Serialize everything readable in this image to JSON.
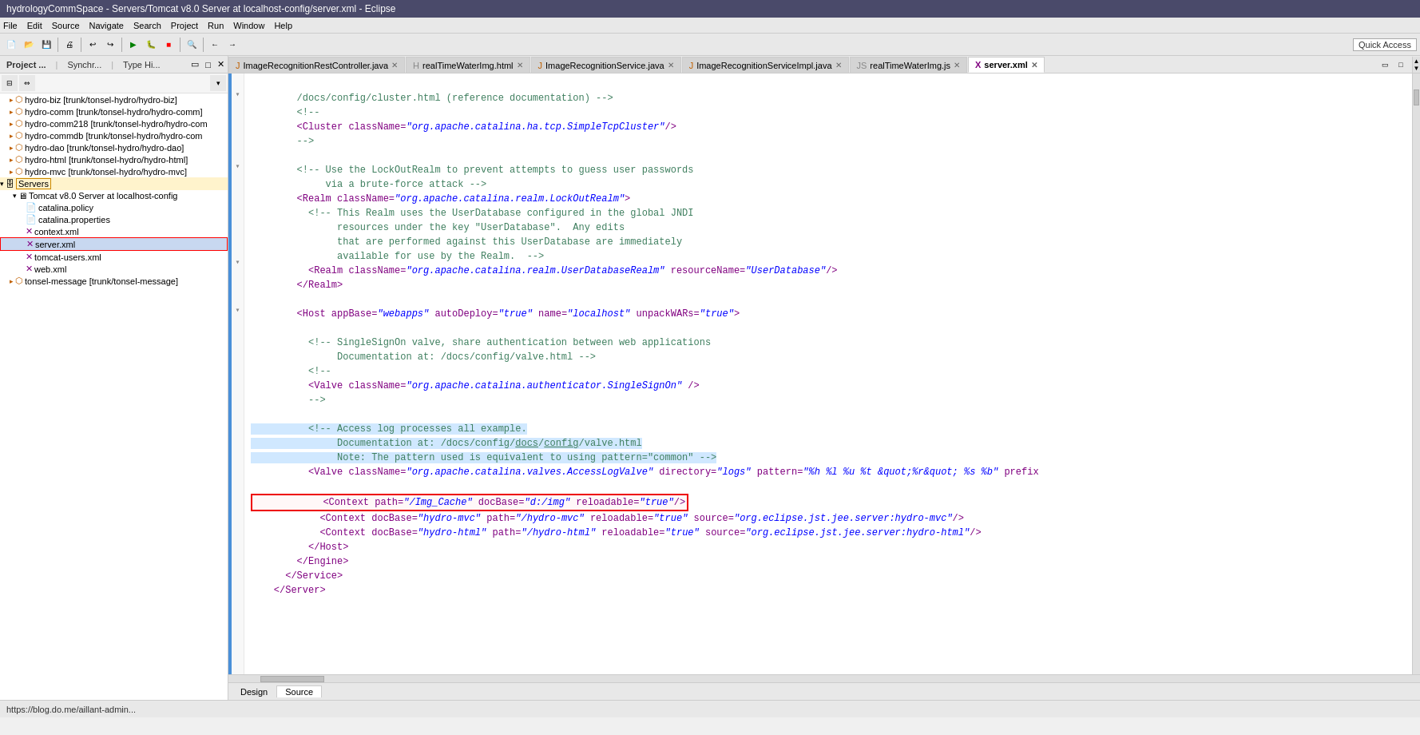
{
  "titlebar": {
    "text": "hydrologyCommSpace - Servers/Tomcat v8.0 Server at localhost-config/server.xml - Eclipse"
  },
  "menubar": {
    "items": [
      "File",
      "Edit",
      "Source",
      "Navigate",
      "Search",
      "Project",
      "Run",
      "Window",
      "Help"
    ]
  },
  "quick_access": "Quick Access",
  "tabs": [
    {
      "label": "ImageRecognitionRestController.java",
      "active": false
    },
    {
      "label": "realTimeWaterImg.html",
      "active": false
    },
    {
      "label": "ImageRecognitionService.java",
      "active": false
    },
    {
      "label": "ImageRecognitionServiceImpl.java",
      "active": false
    },
    {
      "label": "realTimeWaterImg.js",
      "active": false
    },
    {
      "label": "server.xml",
      "active": true
    }
  ],
  "left_panel": {
    "tabs": [
      "Project ...",
      "Synchr...",
      "Type Hi..."
    ]
  },
  "tree": [
    {
      "id": "hydro-biz",
      "label": "hydro-biz [trunk/tonsel-hydro/hydro-biz]",
      "indent": 12,
      "icon": "▸",
      "level": 0
    },
    {
      "id": "hydro-comm",
      "label": "hydro-comm [trunk/tonsel-hydro/hydro-comm]",
      "indent": 12,
      "icon": "▸",
      "level": 0
    },
    {
      "id": "hydro-comm218",
      "label": "hydro-comm218 [trunk/tonsel-hydro/hydro-com",
      "indent": 12,
      "icon": "▸",
      "level": 0
    },
    {
      "id": "hydro-commdb",
      "label": "hydro-commdb [trunk/tonsel-hydro/hydro-com",
      "indent": 12,
      "icon": "▸",
      "level": 0
    },
    {
      "id": "hydro-dao",
      "label": "hydro-dao [trunk/tonsel-hydro/hydro-dao]",
      "indent": 12,
      "icon": "▸",
      "level": 0
    },
    {
      "id": "hydro-html",
      "label": "hydro-html [trunk/tonsel-hydro/hydro-html]",
      "indent": 12,
      "icon": "▸",
      "level": 0
    },
    {
      "id": "hydro-mvc",
      "label": "hydro-mvc [trunk/tonsel-hydro/hydro-mvc]",
      "indent": 12,
      "icon": "▸",
      "level": 0
    },
    {
      "id": "servers",
      "label": "Servers",
      "indent": 0,
      "icon": "▾",
      "level": 0,
      "highlighted": true
    },
    {
      "id": "tomcat",
      "label": "Tomcat v8.0 Server at localhost-config",
      "indent": 16,
      "icon": "▾",
      "level": 1
    },
    {
      "id": "catalina-policy",
      "label": "catalina.policy",
      "indent": 32,
      "icon": "📄",
      "level": 2
    },
    {
      "id": "catalina-properties",
      "label": "catalina.properties",
      "indent": 32,
      "icon": "📄",
      "level": 2
    },
    {
      "id": "context-xml",
      "label": "context.xml",
      "indent": 32,
      "icon": "📄",
      "level": 2
    },
    {
      "id": "server-xml",
      "label": "server.xml",
      "indent": 32,
      "icon": "📄",
      "level": 2,
      "selected": true
    },
    {
      "id": "tomcat-users",
      "label": "tomcat-users.xml",
      "indent": 32,
      "icon": "📄",
      "level": 2
    },
    {
      "id": "web-xml",
      "label": "web.xml",
      "indent": 32,
      "icon": "📄",
      "level": 2
    },
    {
      "id": "tonsel-message",
      "label": "tonsel-message [trunk/tonsel-message]",
      "indent": 12,
      "icon": "▸",
      "level": 0
    }
  ],
  "bottom_tabs": [
    "Design",
    "Source"
  ],
  "active_bottom_tab": "Source",
  "statusbar": {
    "text": "https://blog.do.me/aillant-admin..."
  },
  "code_lines": [
    {
      "num": "",
      "fold": "",
      "content": "        /docs/config/cluster.html (reference documentation) -->",
      "type": "comment"
    },
    {
      "num": "",
      "fold": "▾",
      "content": "        <!--",
      "type": "comment"
    },
    {
      "num": "",
      "fold": "",
      "content": "        <Cluster className=\"org.apache.catalina.ha.tcp.SimpleTcpCluster\"/>",
      "type": "tag"
    },
    {
      "num": "",
      "fold": "",
      "content": "        -->",
      "type": "comment"
    },
    {
      "num": "",
      "fold": "",
      "content": "",
      "type": "text"
    },
    {
      "num": "",
      "fold": "",
      "content": "        <!-- Use the LockOutRealm to prevent attempts to guess user passwords",
      "type": "comment"
    },
    {
      "num": "",
      "fold": "",
      "content": "             via a brute-force attack -->",
      "type": "comment"
    },
    {
      "num": "",
      "fold": "▾",
      "content": "        <Realm className=\"org.apache.catalina.realm.LockOutRealm\">",
      "type": "tag"
    },
    {
      "num": "",
      "fold": "",
      "content": "          <!-- This Realm uses the UserDatabase configured in the global JNDI",
      "type": "comment"
    },
    {
      "num": "",
      "fold": "",
      "content": "               resources under the key \"UserDatabase\".  Any edits",
      "type": "comment"
    },
    {
      "num": "",
      "fold": "",
      "content": "               that are performed against this UserDatabase are immediately",
      "type": "comment"
    },
    {
      "num": "",
      "fold": "",
      "content": "               available for use by the Realm.  -->",
      "type": "comment"
    },
    {
      "num": "",
      "fold": "",
      "content": "          <Realm className=\"org.apache.catalina.realm.UserDatabaseRealm\" resourceName=\"UserDatabase\"/>",
      "type": "tag"
    },
    {
      "num": "",
      "fold": "",
      "content": "        </Realm>",
      "type": "tag"
    },
    {
      "num": "",
      "fold": "",
      "content": "",
      "type": "text"
    },
    {
      "num": "",
      "fold": "▾",
      "content": "        <Host appBase=\"webapps\" autoDeploy=\"true\" name=\"localhost\" unpackWARs=\"true\">",
      "type": "tag"
    },
    {
      "num": "",
      "fold": "",
      "content": "",
      "type": "text"
    },
    {
      "num": "",
      "fold": "",
      "content": "          <!-- SingleSignOn valve, share authentication between web applications",
      "type": "comment"
    },
    {
      "num": "",
      "fold": "",
      "content": "               Documentation at: /docs/config/valve.html -->",
      "type": "comment"
    },
    {
      "num": "",
      "fold": "▾",
      "content": "          <!--",
      "type": "comment"
    },
    {
      "num": "",
      "fold": "",
      "content": "          <Valve className=\"org.apache.catalina.authenticator.SingleSignOn\" />",
      "type": "tag"
    },
    {
      "num": "",
      "fold": "",
      "content": "          -->",
      "type": "comment"
    },
    {
      "num": "",
      "fold": "",
      "content": "",
      "type": "text"
    },
    {
      "num": "",
      "fold": "",
      "content": "          <!-- Access log processes all example.",
      "type": "comment",
      "highlighted": true
    },
    {
      "num": "",
      "fold": "",
      "content": "               Documentation at: /docs/config/valve.html",
      "type": "comment",
      "highlighted": true
    },
    {
      "num": "",
      "fold": "",
      "content": "               Note: The pattern used is equivalent to using pattern=\"common\" -->",
      "type": "comment",
      "highlighted": true
    },
    {
      "num": "",
      "fold": "",
      "content": "          <Valve className=\"org.apache.catalina.valves.AccessLogValve\" directory=\"logs\" pattern=\"%h %l %u %t &quot;%r&quot; %s %b\" prefix",
      "type": "tag"
    },
    {
      "num": "",
      "fold": "",
      "content": "",
      "type": "text"
    },
    {
      "num": "",
      "fold": "",
      "content": "            <Context path=\"/Img_Cache\" docBase=\"d:/img\" reloadable=\"true\"/>",
      "type": "redbox"
    },
    {
      "num": "",
      "fold": "",
      "content": "            <Context docBase=\"hydro-mvc\" path=\"/hydro-mvc\" reloadable=\"true\" source=\"org.eclipse.jst.jee.server:hydro-mvc\"/>",
      "type": "tag"
    },
    {
      "num": "",
      "fold": "",
      "content": "            <Context docBase=\"hydro-html\" path=\"/hydro-html\" reloadable=\"true\" source=\"org.eclipse.jst.jee.server:hydro-html\"/>",
      "type": "tag"
    },
    {
      "num": "",
      "fold": "",
      "content": "          </Host>",
      "type": "tag"
    },
    {
      "num": "",
      "fold": "",
      "content": "        </Engine>",
      "type": "tag"
    },
    {
      "num": "",
      "fold": "",
      "content": "      </Service>",
      "type": "tag"
    },
    {
      "num": "",
      "fold": "",
      "content": "    </Server>",
      "type": "tag"
    }
  ]
}
